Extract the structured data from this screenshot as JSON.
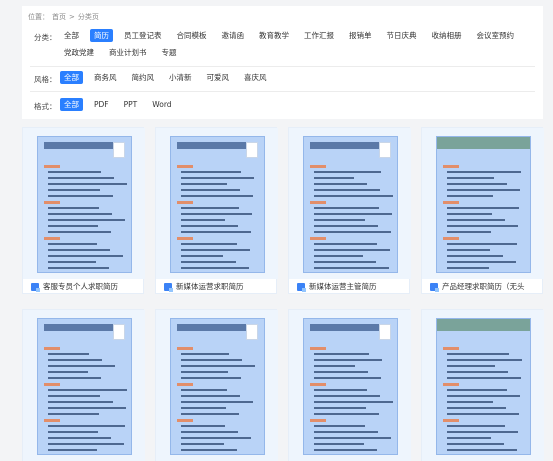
{
  "breadcrumb": {
    "prefix": "位置：",
    "home": "首页",
    "separator": ">",
    "current": "分类页"
  },
  "filters": {
    "category": {
      "label": "分类：",
      "options": [
        "全部",
        "简历",
        "员工登记表",
        "合同模板",
        "邀请函",
        "教育教学",
        "工作汇报",
        "报销单",
        "节日庆典",
        "收纳相册",
        "会议室预约",
        "党政党建",
        "商业计划书",
        "专题"
      ],
      "selected": "简历"
    },
    "style": {
      "label": "风格：",
      "options": [
        "全部",
        "商务风",
        "简约风",
        "小清新",
        "可爱风",
        "喜庆风"
      ],
      "selected": "全部"
    },
    "format": {
      "label": "格式：",
      "options": [
        "全部",
        "PDF",
        "PPT",
        "Word"
      ],
      "selected": "全部"
    }
  },
  "templates": [
    {
      "title": "客服专员个人求职简历",
      "icon": "word-doc-icon"
    },
    {
      "title": "新媒体运营求职简历",
      "icon": "word-doc-icon"
    },
    {
      "title": "新媒体运营主管简历",
      "icon": "word-doc-icon"
    },
    {
      "title": "产品经理求职简历（无头",
      "icon": "word-doc-icon"
    },
    {
      "title": "",
      "icon": "word-doc-icon"
    },
    {
      "title": "",
      "icon": "word-doc-icon"
    },
    {
      "title": "",
      "icon": "word-doc-icon"
    },
    {
      "title": "",
      "icon": "word-doc-icon"
    }
  ],
  "colors": {
    "accent": "#2a7fff",
    "thumb_bg": "#b9d3f7",
    "header_bar": "#5b79a8",
    "section_orange": "#e28e6a"
  }
}
